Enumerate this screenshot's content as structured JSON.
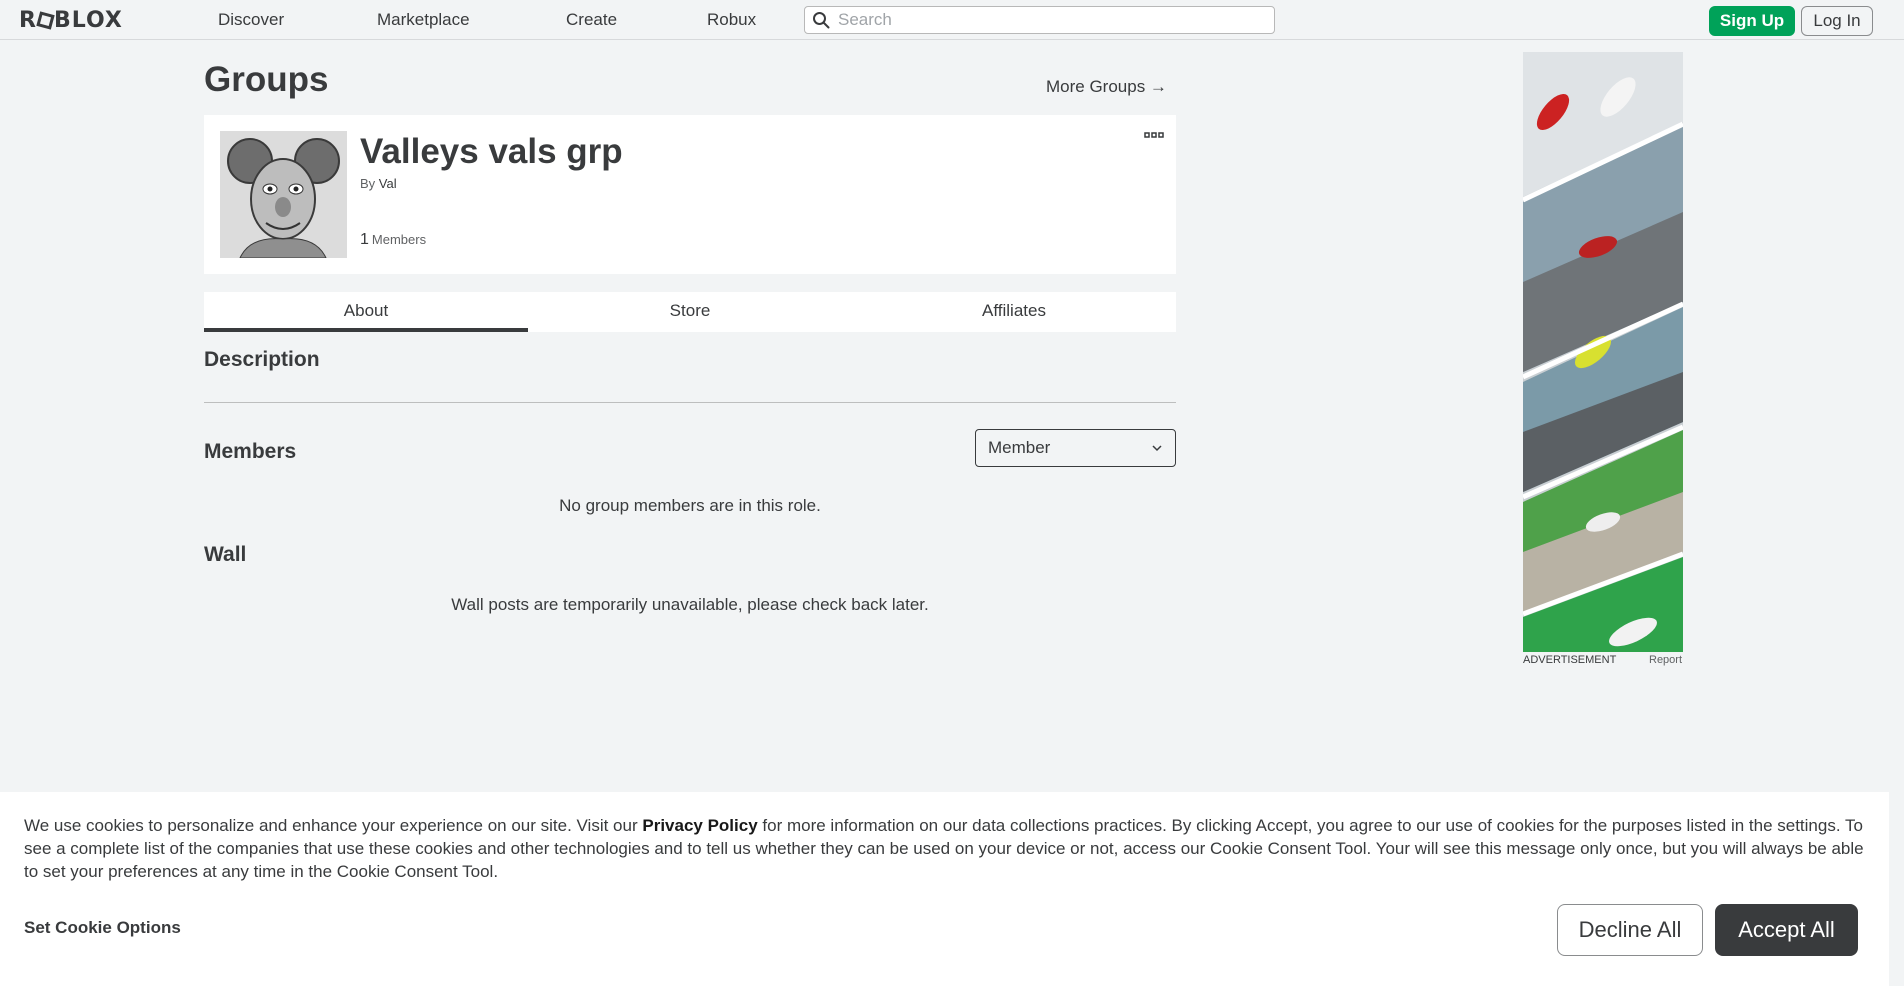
{
  "nav": {
    "logo": "ROBLOX",
    "links": [
      "Discover",
      "Marketplace",
      "Create",
      "Robux"
    ],
    "search_placeholder": "Search",
    "signup_label": "Sign Up",
    "login_label": "Log In"
  },
  "page": {
    "title": "Groups",
    "more_groups": "More Groups →"
  },
  "group": {
    "name": "Valleys vals grp",
    "by_label": "By",
    "owner": "Val",
    "member_count": "1",
    "member_label": "Members",
    "thumbnail_icon": "group-emblem-image",
    "menu_icon": "ellipsis-icon"
  },
  "tabs": [
    "About",
    "Store",
    "Affiliates"
  ],
  "about": {
    "description_title": "Description",
    "members_title": "Members",
    "role_selected": "Member",
    "members_empty": "No group members are in this role.",
    "wall_title": "Wall",
    "wall_empty": "Wall posts are temporarily unavailable, please check back later."
  },
  "ad": {
    "label": "ADVERTISEMENT",
    "report": "Report",
    "image_icon": "car-racing-ad-image"
  },
  "cookie": {
    "text_before": "We use cookies to personalize and enhance your experience on our site. Visit our ",
    "privacy_link": "Privacy Policy",
    "text_after": " for more information on our data collections practices. By clicking Accept, you agree to our use of cookies for the purposes listed in the settings. To see a complete list of the companies that use these cookies and other technologies and to tell us whether they can be used on your device or not, access our Cookie Consent Tool. Your will see this message only once, but you will always be able to set your preferences at any time in the Cookie Consent Tool.",
    "set_options": "Set Cookie Options",
    "decline": "Decline All",
    "accept": "Accept All"
  },
  "colors": {
    "background": "#f2f4f5",
    "text": "#393b3d",
    "signup_green": "#00a259",
    "accept_dark": "#393b3d"
  }
}
